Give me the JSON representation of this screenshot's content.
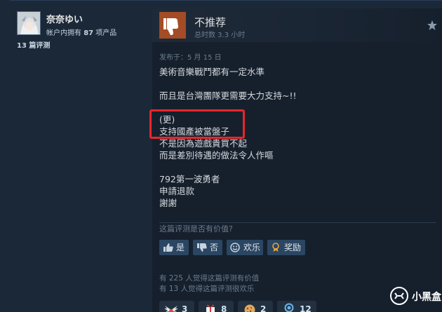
{
  "reviewer": {
    "username": "奈奈ゆい",
    "owned_prefix": "帐户内拥有",
    "owned_count": "87",
    "owned_suffix": "项产品",
    "review_count": "13 篇评测"
  },
  "review": {
    "verdict": "不推荐",
    "playtime": "总时数 3.3 小时",
    "posted": "发布于：5 月 15 日",
    "lines": [
      "美術音樂戰鬥都有一定水準",
      "",
      "而且是台灣團隊更需要大力支持~!!",
      "",
      "(更)",
      "支持國產被當盤子",
      "不是因為遊戲貴買不起",
      "而是差別待遇的做法令人作嘔",
      "",
      "792第一波勇者",
      "申請退款",
      "謝謝"
    ]
  },
  "helpful": {
    "question": "这篇评测是否有价值?",
    "buttons": {
      "yes": "是",
      "no": "否",
      "funny": "欢乐",
      "award": "奖励"
    },
    "stats": [
      "有 225 人觉得这篇评测有价值",
      "有 13 人觉得这篇评测很欢乐"
    ]
  },
  "awards": [
    {
      "icon": "wings-award-icon",
      "count": "3"
    },
    {
      "icon": "gift-award-icon",
      "count": "8"
    },
    {
      "icon": "cookie-award-icon",
      "count": "2"
    },
    {
      "icon": "medal-award-icon",
      "count": "12"
    }
  ],
  "watermark": {
    "text": "小黑盒"
  },
  "colors": {
    "background": "#1b2838",
    "card": "#16202d",
    "thumb_down": "#a34c25",
    "button": "#2b4662",
    "highlight": "#e8262a"
  }
}
